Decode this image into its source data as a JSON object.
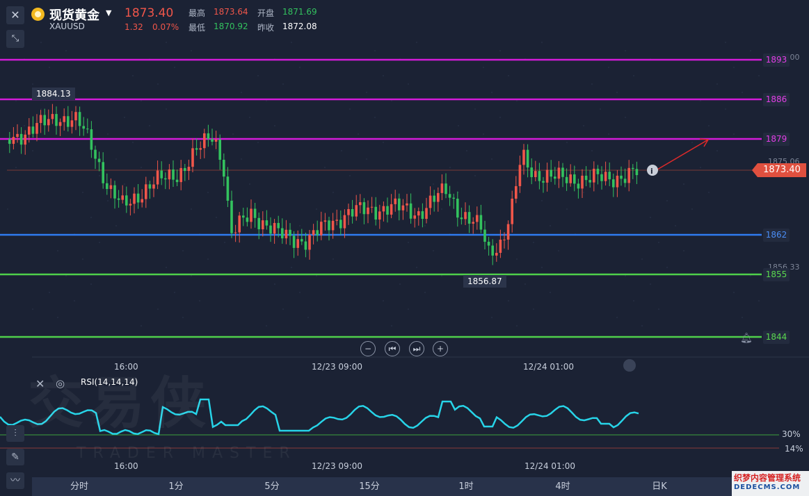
{
  "header": {
    "close_icon": "close-icon",
    "collapse_icon": "collapse-icon",
    "symbol_name": "现货黄金",
    "symbol_code": "XAUUSD",
    "price": "1873.40",
    "change": "1.32",
    "change_pct": "0.07%",
    "high_label": "最高",
    "high": "1873.64",
    "low_label": "最低",
    "low": "1870.92",
    "open_label": "开盘",
    "open": "1871.69",
    "prev_label": "昨收",
    "prev_close": "1872.08"
  },
  "levels": [
    {
      "label": "1893",
      "color": "#d41bd8"
    },
    {
      "label": "1886",
      "color": "#d41bd8"
    },
    {
      "label": "1879",
      "color": "#d41bd8"
    },
    {
      "label": "1862",
      "color": "#2f7bf0"
    },
    {
      "label": "1855",
      "color": "#4fd04a"
    },
    {
      "label": "1844",
      "color": "#4fd04a"
    }
  ],
  "axis_dim_labels": [
    "1875.06",
    "1856.33"
  ],
  "current_price_tag": "1873.40",
  "high_marker": "1884.13",
  "low_marker": "1856.87",
  "time_axis": [
    "16:00",
    "12/23 09:00",
    "12/24 01:00"
  ],
  "nav_buttons": [
    "zoom-out",
    "step-back",
    "step-forward",
    "zoom-in"
  ],
  "rsi": {
    "label": "RSI(14,14,14)",
    "levels": [
      "30%",
      "14%"
    ],
    "line_color": "#27d4e8"
  },
  "watermark": {
    "main": "交易侠",
    "sub": "TRADER MASTER"
  },
  "tabs": [
    "分时",
    "1分",
    "5分",
    "15分",
    "1时",
    "4时",
    "日K"
  ],
  "active_tab": "日K",
  "corner_logo": {
    "line1": "织梦内容管理系统",
    "line2": "DEDECMS.COM"
  },
  "colors": {
    "up": "#f0564a",
    "down": "#33c25e",
    "background": "#1b2234"
  }
}
